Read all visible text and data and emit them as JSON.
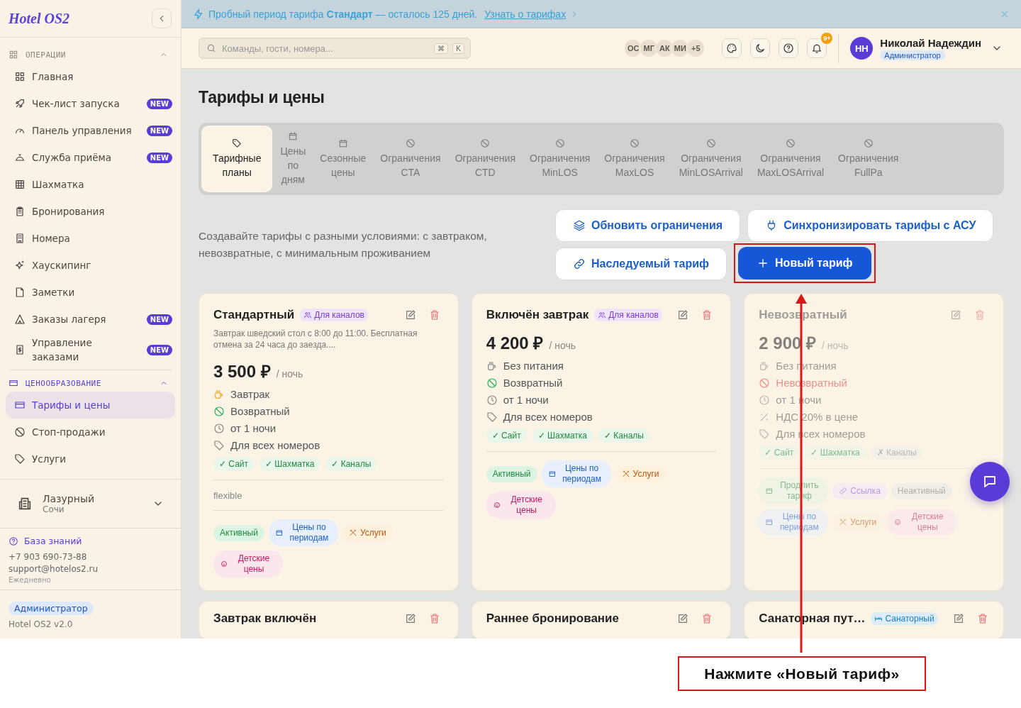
{
  "sidebar": {
    "logo": "Hotel OS2",
    "sections": [
      {
        "title": "ОПЕРАЦИИ",
        "active": false,
        "expanded": true,
        "items": [
          {
            "label": "Главная",
            "selected": false
          },
          {
            "label": "Чек-лист запуска",
            "badge": "NEW",
            "selected": false
          },
          {
            "label": "Панель управления",
            "badge": "NEW",
            "selected": false
          },
          {
            "label": "Служба приёма",
            "badge": "NEW",
            "selected": false
          },
          {
            "label": "Шахматка",
            "selected": false
          },
          {
            "label": "Бронирования",
            "selected": false
          },
          {
            "label": "Номера",
            "selected": false
          },
          {
            "label": "Хаускипинг",
            "selected": false
          },
          {
            "label": "Заметки",
            "selected": false
          },
          {
            "label": "Заказы лагеря",
            "badge": "NEW",
            "selected": false
          },
          {
            "label": "Управление заказами",
            "badge": "NEW",
            "selected": false
          }
        ]
      },
      {
        "title": "ЦЕНООБРАЗОВАНИЕ",
        "active": true,
        "expanded": true,
        "items": [
          {
            "label": "Тарифы и цены",
            "selected": true
          },
          {
            "label": "Стоп-продажи",
            "selected": false
          },
          {
            "label": "Услуги",
            "selected": false
          }
        ]
      }
    ],
    "property": {
      "name": "Лазурный",
      "city": "Сочи"
    },
    "help": {
      "link": "База знаний",
      "phone": "+7 903 690-73-88",
      "email": "support@hotelos2.ru",
      "hours": "Ежедневно"
    },
    "footer": {
      "role": "Администратор",
      "version": "Hotel OS2 v2.0"
    }
  },
  "banner": {
    "text": "Пробный период тарифа **Стандарт** — осталось 125 дней.",
    "link": "Узнать о тарифах"
  },
  "topbar": {
    "search": {
      "placeholder": "Команды, гости, номера...",
      "keys": [
        "⌘",
        "K"
      ]
    },
    "avatars": [
      "ОС",
      "МГ",
      "АК",
      "МИ",
      "+5"
    ],
    "notifications": "9+",
    "user": {
      "initials": "НН",
      "name": "Николай Надеждин",
      "role": "Администратор"
    }
  },
  "page": {
    "title": "Тарифы и цены",
    "tabs": [
      {
        "label": "Тарифные планы",
        "selected": true
      },
      {
        "label": "Цены по дням",
        "selected": false
      },
      {
        "label": "Сезонные цены",
        "selected": false
      },
      {
        "label": "Ограничения CTA",
        "selected": false
      },
      {
        "label": "Ограничения CTD",
        "selected": false
      },
      {
        "label": "Ограничения MinLOS",
        "selected": false
      },
      {
        "label": "Ограничения MaxLOS",
        "selected": false
      },
      {
        "label": "Ограничения MinLOSArrival",
        "selected": false
      },
      {
        "label": "Ограничения MaxLOSArrival",
        "selected": false
      },
      {
        "label": "Ограничения FullPa",
        "selected": false
      }
    ],
    "description": "Создавайте тарифы с разными условиями: с завтраком, невозвратные, с минимальным проживанием",
    "buttons": [
      {
        "label": "Обновить ограничения",
        "kind": "secondary",
        "highlighted": false
      },
      {
        "label": "Синхронизировать тарифы с АСУ",
        "kind": "secondary",
        "highlighted": false
      },
      {
        "label": "Наследуемый тариф",
        "kind": "secondary",
        "highlighted": false
      },
      {
        "label": "Новый тариф",
        "kind": "primary",
        "highlighted": true
      }
    ],
    "cards": [
      {
        "title": "Стандартный",
        "badge": {
          "label": "Для каналов",
          "kind": "channels"
        },
        "description": "Завтрак шведский стол с 8:00 до 11:00. Бесплатная отмена за 24 часа до заезда....",
        "price": "3 500 ₽",
        "unit": "/ ночь",
        "active": true,
        "features": [
          {
            "kind": "meal",
            "label": "Завтрак",
            "included": true
          },
          {
            "kind": "refund",
            "label": "Возвратный",
            "refundable": true
          },
          {
            "kind": "stay",
            "label": "от 1 ночи"
          },
          {
            "kind": "rooms",
            "label": "Для всех номеров"
          }
        ],
        "channels": [
          {
            "label": "✓ Сайт",
            "enabled": true
          },
          {
            "label": "✓ Шахматка",
            "enabled": true
          },
          {
            "label": "✓ Каналы",
            "enabled": true
          }
        ],
        "note": "flexible",
        "chips": [
          {
            "kind": "status",
            "label": "Активный"
          },
          {
            "kind": "periods",
            "label": "Цены по периодам"
          },
          {
            "kind": "services",
            "label": "Услуги"
          },
          {
            "kind": "kids",
            "label": "Детские цены"
          }
        ]
      },
      {
        "title": "Включён завтрак",
        "badge": {
          "label": "Для каналов",
          "kind": "channels"
        },
        "price": "4 200 ₽",
        "unit": "/ ночь",
        "active": true,
        "features": [
          {
            "kind": "meal",
            "label": "Без питания",
            "included": false
          },
          {
            "kind": "refund",
            "label": "Возвратный",
            "refundable": true
          },
          {
            "kind": "stay",
            "label": "от 1 ночи"
          },
          {
            "kind": "rooms",
            "label": "Для всех номеров"
          }
        ],
        "channels": [
          {
            "label": "✓ Сайт",
            "enabled": true
          },
          {
            "label": "✓ Шахматка",
            "enabled": true
          },
          {
            "label": "✓ Каналы",
            "enabled": true
          }
        ],
        "chips": [
          {
            "kind": "status",
            "label": "Активный"
          },
          {
            "kind": "periods",
            "label": "Цены по периодам"
          },
          {
            "kind": "services",
            "label": "Услуги"
          },
          {
            "kind": "kids",
            "label": "Детские цены"
          }
        ]
      },
      {
        "title": "Невозвратный",
        "price": "2 900 ₽",
        "unit": "/ ночь",
        "active": false,
        "features": [
          {
            "kind": "meal",
            "label": "Без питания",
            "included": false
          },
          {
            "kind": "refund",
            "label": "Невозвратный",
            "refundable": false
          },
          {
            "kind": "stay",
            "label": "от 1 ночи"
          },
          {
            "kind": "vat",
            "label": "НДС 20% в цене"
          },
          {
            "kind": "rooms",
            "label": "Для всех номеров"
          }
        ],
        "channels": [
          {
            "label": "✓ Сайт",
            "enabled": true
          },
          {
            "label": "✓ Шахматка",
            "enabled": true
          },
          {
            "label": "✗ Каналы",
            "enabled": false
          }
        ],
        "chips": [
          {
            "kind": "extend",
            "label": "Продлить тариф"
          },
          {
            "kind": "link",
            "label": "Ссылка"
          },
          {
            "kind": "status",
            "label": "Неактивный"
          },
          {
            "kind": "periods",
            "label": "Цены по периодам"
          },
          {
            "kind": "services",
            "label": "Услуги"
          },
          {
            "kind": "kids",
            "label": "Детские цены"
          }
        ]
      },
      {
        "title": "Завтрак включён",
        "active": true
      },
      {
        "title": "Раннее бронирование",
        "active": true
      },
      {
        "title": "Санаторная пут…",
        "badge": {
          "label": "Санаторный",
          "kind": "sanatorium"
        },
        "active": true
      }
    ]
  },
  "annotation": {
    "text": "Нажмите «Новый тариф»"
  }
}
